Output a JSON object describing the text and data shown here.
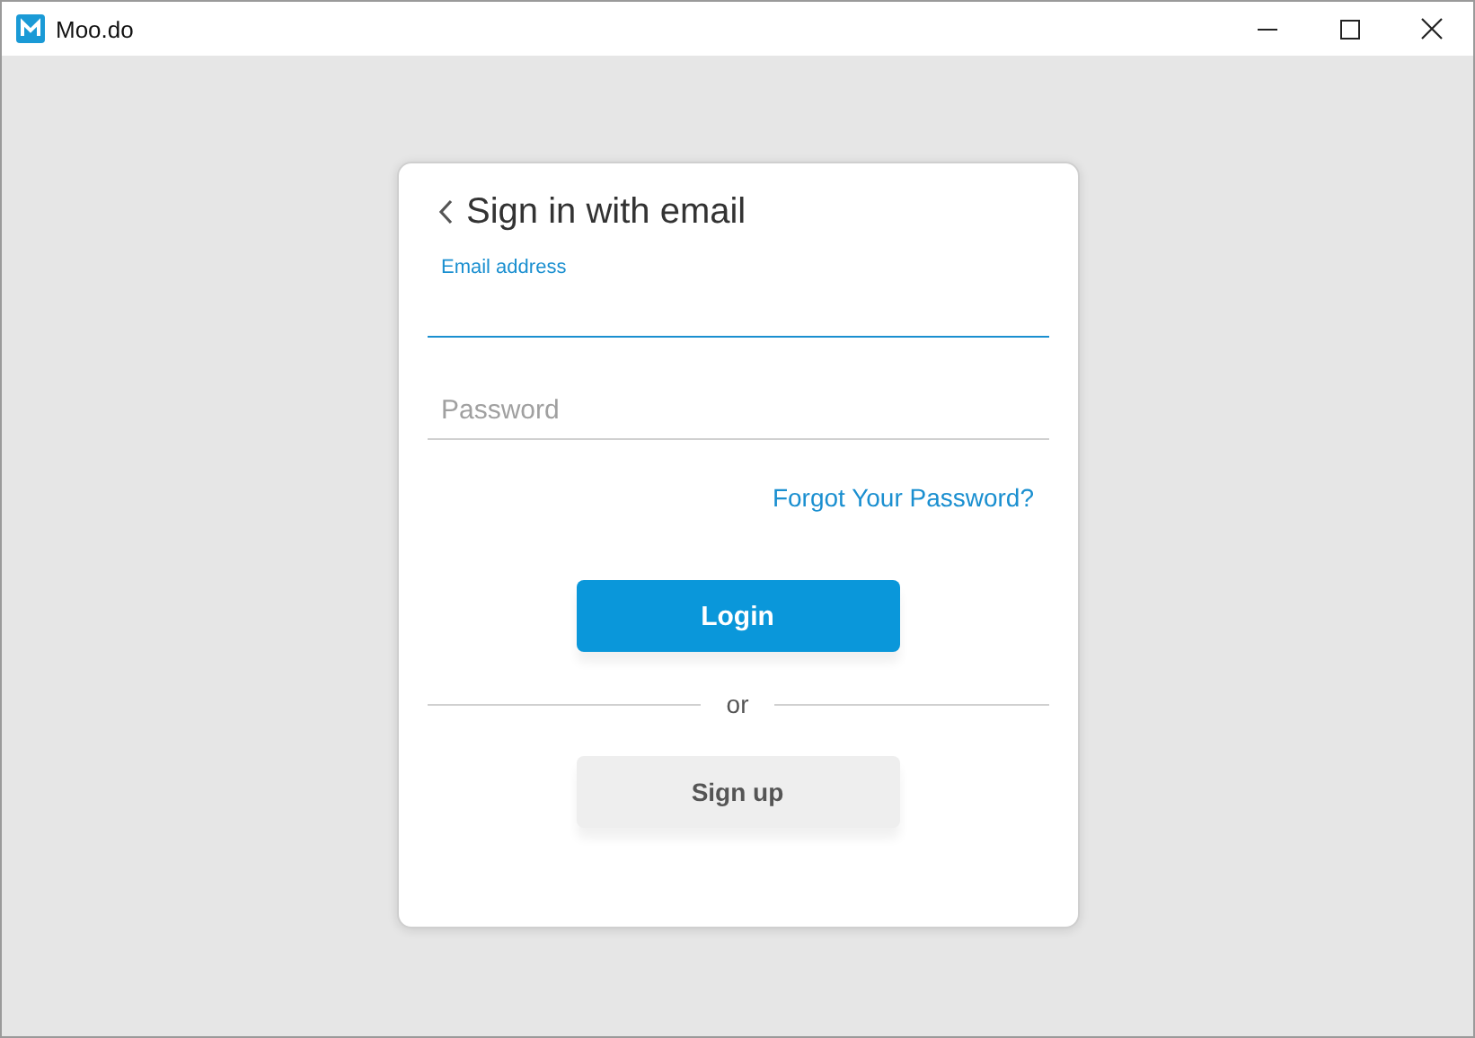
{
  "window": {
    "title": "Moo.do"
  },
  "card": {
    "title": "Sign in with email",
    "fields": [
      {
        "label": "Email address",
        "focused": true
      },
      {
        "placeholder": "Password",
        "focused": false
      }
    ],
    "forgot_link": "Forgot Your Password?",
    "login_button": "Login",
    "divider": "or",
    "signup_button": "Sign up"
  }
}
